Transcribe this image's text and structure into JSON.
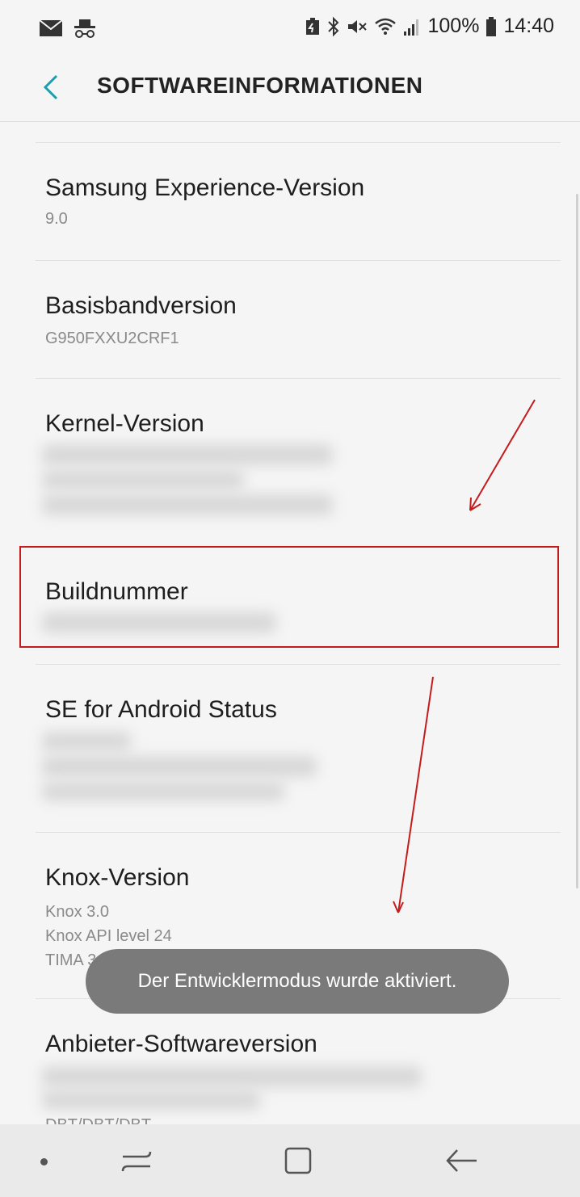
{
  "status_bar": {
    "battery_percent": "100%",
    "time": "14:40",
    "icons": [
      "mail-icon",
      "incognito-icon",
      "battery-saver-icon",
      "bluetooth-icon",
      "mute-icon",
      "wifi-icon",
      "signal-icon",
      "battery-icon"
    ]
  },
  "header": {
    "title": "SOFTWAREINFORMATIONEN",
    "back_icon": "chevron-left-icon"
  },
  "items": [
    {
      "title": "Samsung Experience-Version",
      "subtitle": [
        "9.0"
      ]
    },
    {
      "title": "Basisbandversion",
      "subtitle": [
        "G950FXXU2CRF1"
      ]
    },
    {
      "title": "Kernel-Version",
      "subtitle": []
    },
    {
      "title": "Buildnummer",
      "subtitle": []
    },
    {
      "title": "SE for Android Status",
      "subtitle": []
    },
    {
      "title": "Knox-Version",
      "subtitle": [
        "Knox 3.0",
        "Knox API level 24",
        "TIMA 3.3.0"
      ]
    },
    {
      "title": "Anbieter-Softwareversion",
      "subtitle": [
        "DBT/DBT/DBT"
      ]
    }
  ],
  "toast": {
    "message": "Der Entwicklermodus wurde aktiviert."
  },
  "navbar": {
    "icons": [
      "nav-dot-icon",
      "recents-icon",
      "home-icon",
      "back-icon"
    ]
  },
  "colors": {
    "accent": "#1a9fb0",
    "annotation_red": "#c41c1c",
    "toast_bg": "#7a7a7a"
  }
}
